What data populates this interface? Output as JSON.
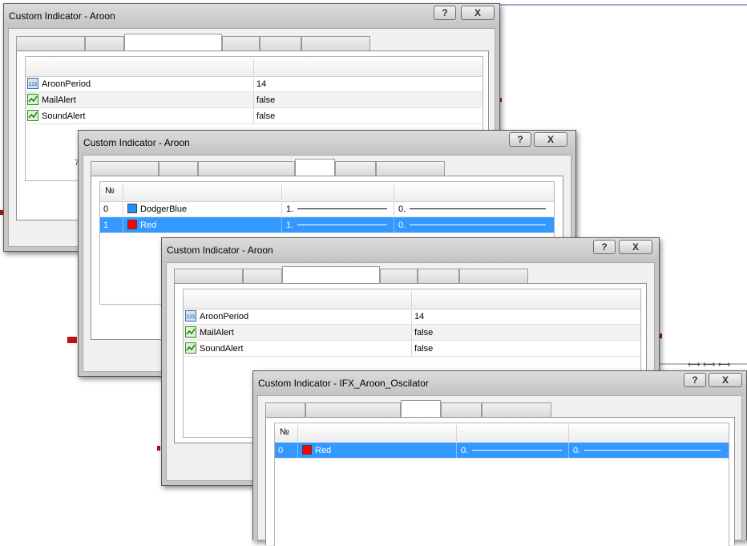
{
  "colors": {
    "selection": "#3399ff",
    "dodger_blue": "#1e90ff",
    "red": "#ff0000"
  },
  "background_chart": {
    "axis_label": "7 0"
  },
  "window1": {
    "title": "Custom Indicator - Aroon",
    "help_label": "?",
    "close_label": "X",
    "params": [
      {
        "name": "AroonPeriod",
        "value": "14",
        "icon": "integer-param-icon"
      },
      {
        "name": "MailAlert",
        "value": "false",
        "icon": "boolean-param-icon"
      },
      {
        "name": "SoundAlert",
        "value": "false",
        "icon": "boolean-param-icon"
      }
    ]
  },
  "window2": {
    "title": "Custom Indicator - Aroon",
    "help_label": "?",
    "close_label": "X",
    "col_no": "№",
    "buffers": [
      {
        "no": "0",
        "color_name": "DodgerBlue",
        "width": "1.",
        "style": "0."
      },
      {
        "no": "1",
        "color_name": "Red",
        "width": "1.",
        "style": "0."
      }
    ]
  },
  "window3": {
    "title": "Custom Indicator - Aroon",
    "help_label": "?",
    "close_label": "X",
    "params": [
      {
        "name": "AroonPeriod",
        "value": "14",
        "icon": "integer-param-icon"
      },
      {
        "name": "MailAlert",
        "value": "false",
        "icon": "boolean-param-icon"
      },
      {
        "name": "SoundAlert",
        "value": "false",
        "icon": "boolean-param-icon"
      }
    ]
  },
  "window4": {
    "title": "Custom Indicator - IFX_Aroon_Oscilator",
    "help_label": "?",
    "close_label": "X",
    "col_no": "№",
    "buffers": [
      {
        "no": "0",
        "color_name": "Red",
        "width": "0.",
        "style": "0."
      }
    ]
  }
}
